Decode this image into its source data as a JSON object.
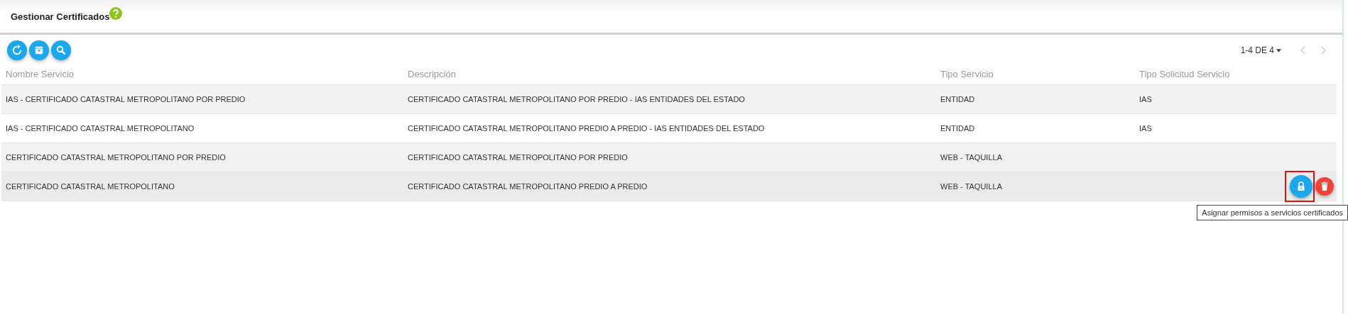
{
  "header": {
    "title": "Gestionar Certificados",
    "help": true
  },
  "toolbar": [
    {
      "kind": "refresh"
    },
    {
      "kind": "export"
    },
    {
      "kind": "search"
    }
  ],
  "pagination": {
    "label": "1-4 DE 4",
    "prev_disabled": true,
    "next_disabled": true
  },
  "table": {
    "columns": [
      "Nombre Servicio",
      "Descripción",
      "Tipo Servicio",
      "Tipo Solicitud Servicio"
    ],
    "rows": [
      {
        "cells": [
          "IAS - CERTIFICADO CATASTRAL METROPOLITANO POR PREDIO",
          "CERTIFICADO CATASTRAL METROPOLITANO POR PREDIO - IAS ENTIDADES DEL ESTADO",
          "ENTIDAD",
          "IAS"
        ]
      },
      {
        "cells": [
          "IAS - CERTIFICADO CATASTRAL METROPOLITANO",
          "CERTIFICADO CATASTRAL METROPOLITANO PREDIO A PREDIO - IAS ENTIDADES DEL ESTADO",
          "ENTIDAD",
          "IAS"
        ]
      },
      {
        "cells": [
          "CERTIFICADO CATASTRAL METROPOLITANO POR PREDIO",
          "CERTIFICADO CATASTRAL METROPOLITANO POR PREDIO",
          "WEB - TAQUILLA",
          ""
        ]
      },
      {
        "cells": [
          "CERTIFICADO CATASTRAL METROPOLITANO",
          "CERTIFICADO CATASTRAL METROPOLITANO PREDIO A PREDIO",
          "WEB - TAQUILLA",
          ""
        ],
        "actions": [
          {
            "kind": "permissions",
            "highlighted": true,
            "tooltip": "Asignar permisos a servicios certificados"
          },
          {
            "kind": "delete"
          }
        ]
      }
    ]
  }
}
